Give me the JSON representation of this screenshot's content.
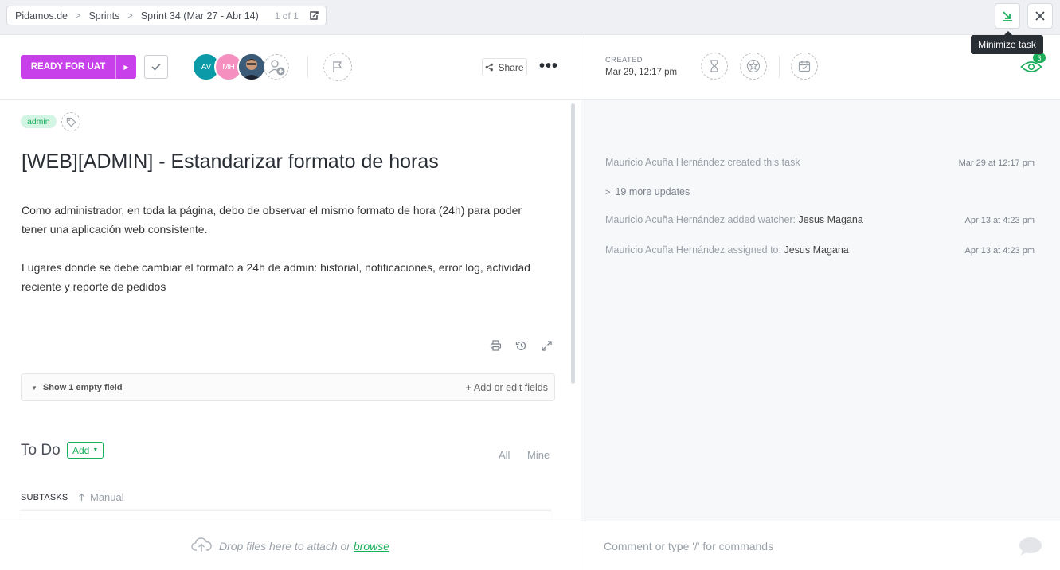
{
  "breadcrumb": {
    "items": [
      "Pidamos.de",
      "Sprints",
      "Sprint 34 (Mar 27 - Abr 14)"
    ],
    "position": "1 of 1"
  },
  "window_controls": {
    "minimize_tooltip": "Minimize task"
  },
  "task_header": {
    "status_label": "READY FOR UAT",
    "status_color": "#c840e9",
    "assignees": [
      {
        "initials": "AV",
        "color": "#0b9aa8"
      },
      {
        "initials": "MH",
        "color": "#f48fc0"
      },
      {
        "initials": "",
        "color": "#2f4b66"
      }
    ],
    "share_label": "Share"
  },
  "task": {
    "tag": "admin",
    "title": "[WEB][ADMIN] - Estandarizar formato de horas",
    "description": [
      "Como administrador, en toda la página, debo de observar el mismo formato de hora (24h) para poder tener una aplicación web consistente.",
      "Lugares donde se debe cambiar el formato a 24h de admin: historial, notificaciones, error log, actividad reciente y reporte de pedidos"
    ],
    "show_fields_label": "Show 1 empty field",
    "edit_fields_label": "+ Add or edit fields"
  },
  "todo": {
    "title": "To Do",
    "add_label": "Add",
    "filters": [
      "All",
      "Mine"
    ],
    "subtasks_label": "SUBTASKS",
    "sort_label": "Manual"
  },
  "sidebar": {
    "created_label": "CREATED",
    "created_value": "Mar 29, 12:17 pm",
    "watchers_count": "3",
    "activity": [
      {
        "pre": "Mauricio Acuña Hernández created this task",
        "post": "",
        "time": "Mar 29 at 12:17 pm"
      },
      {
        "pre": "19 more updates",
        "post": "",
        "time": ""
      },
      {
        "pre": "Mauricio Acuña Hernández added watcher: ",
        "post": "Jesus Magana",
        "time": "Apr 13 at 4:23 pm"
      },
      {
        "pre": "Mauricio Acuña Hernández assigned to: ",
        "post": "Jesus Magana",
        "time": "Apr 13 at 4:23 pm"
      }
    ]
  },
  "bottom": {
    "drop_text": "Drop files here to attach or ",
    "browse_label": "browse",
    "comment_placeholder": "Comment or type '/' for commands"
  }
}
